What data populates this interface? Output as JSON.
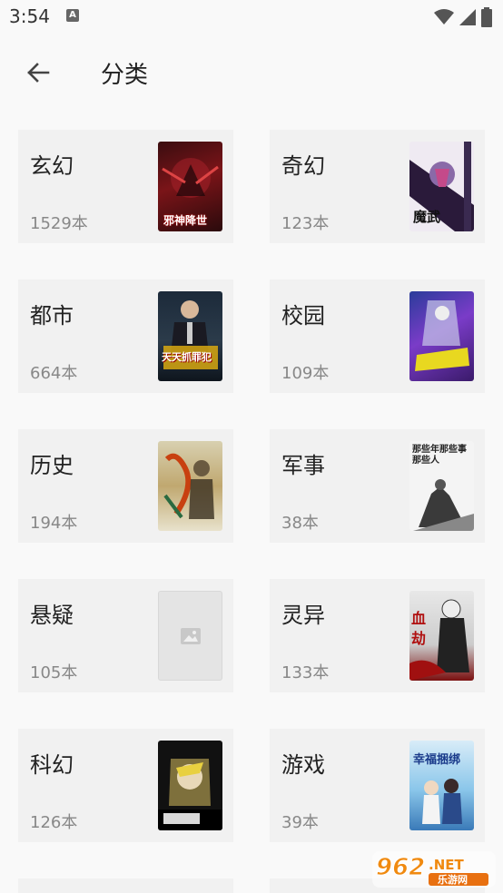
{
  "status": {
    "time": "3:54",
    "a_icon": "A"
  },
  "header": {
    "title": "分类"
  },
  "categories": [
    {
      "name": "玄幻",
      "count": "1529本",
      "cover_text": "邪神降世"
    },
    {
      "name": "奇幻",
      "count": "123本",
      "cover_text": "魔武"
    },
    {
      "name": "都市",
      "count": "664本",
      "cover_text": "天天抓罪犯"
    },
    {
      "name": "校园",
      "count": "109本",
      "cover_text": ""
    },
    {
      "name": "历史",
      "count": "194本",
      "cover_text": ""
    },
    {
      "name": "军事",
      "count": "38本",
      "cover_text": "那些年那些事那些人"
    },
    {
      "name": "悬疑",
      "count": "105本",
      "cover_text": ""
    },
    {
      "name": "灵异",
      "count": "133本",
      "cover_text": "血劫"
    },
    {
      "name": "科幻",
      "count": "126本",
      "cover_text": ""
    },
    {
      "name": "游戏",
      "count": "39本",
      "cover_text": "幸福捆绑"
    }
  ],
  "watermark": {
    "brand": "962",
    "tld": ".NET",
    "sub": "乐游网"
  },
  "colors": {
    "background": "#f9f9f9",
    "card": "#f1f1f1",
    "text": "#222222",
    "muted": "#888888"
  }
}
